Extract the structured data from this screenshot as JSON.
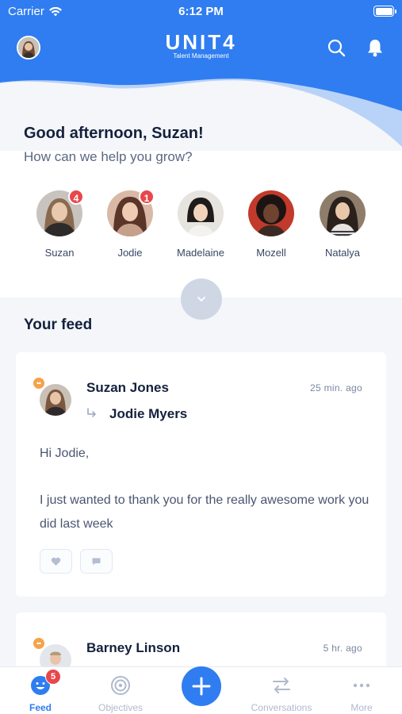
{
  "status_bar": {
    "carrier": "Carrier",
    "time": "6:12 PM"
  },
  "header": {
    "brand": "UNIT4",
    "brand_sub": "Talent Management",
    "accent": "#2f7df0"
  },
  "greeting": {
    "title": "Good afternoon, Suzan!",
    "subtitle": "How can we help you grow?"
  },
  "people": [
    {
      "name": "Suzan",
      "badge": "4"
    },
    {
      "name": "Jodie",
      "badge": "1"
    },
    {
      "name": "Madelaine",
      "badge": ""
    },
    {
      "name": "Mozell",
      "badge": ""
    },
    {
      "name": "Natalya",
      "badge": ""
    }
  ],
  "feed": {
    "title": "Your feed",
    "posts": [
      {
        "author": "Suzan Jones",
        "time": "25 min. ago",
        "recipient": "Jodie Myers",
        "greeting_line": "Hi Jodie,",
        "body": "I just wanted to thank you for the really awesome work you did last week"
      },
      {
        "author": "Barney Linson",
        "time": "5 hr. ago"
      }
    ]
  },
  "tabs": [
    {
      "label": "Feed",
      "badge": "5",
      "active": true
    },
    {
      "label": "Objectives"
    },
    {
      "label": "Conversations"
    },
    {
      "label": "More"
    }
  ]
}
